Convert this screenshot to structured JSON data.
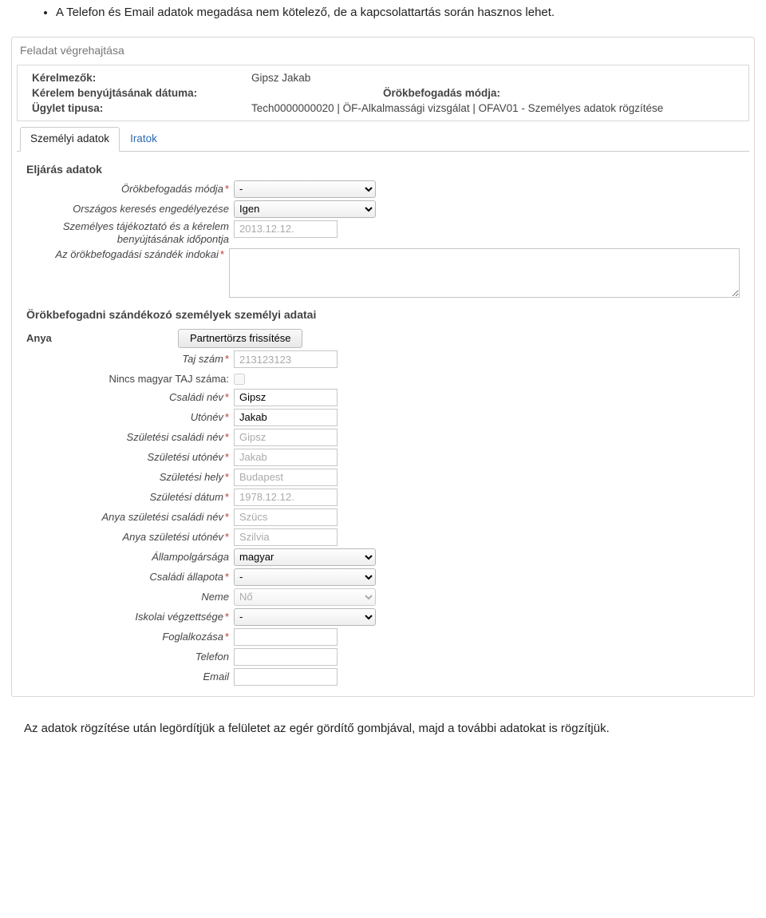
{
  "doc": {
    "bullet1": "A Telefon és Email adatok megadása nem kötelező, de a kapcsolattartás során hasznos lehet.",
    "footnote": "Az adatok rögzítése után legördítjük a felületet az egér gördítő gombjával, majd a további adatokat is rögzítjük."
  },
  "panel": {
    "title": "Feladat végrehajtása",
    "info": {
      "kerelmezok_lbl": "Kérelmezők:",
      "kerelmezok_val": "Gipsz Jakab",
      "benyujtas_lbl": "Kérelem benyújtásának dátuma:",
      "benyujtas_val": "",
      "orokmod_lbl": "Örökbefogadás módja:",
      "orokmod_val": "",
      "ugylet_lbl": "Ügylet tipusa:",
      "ugylet_val": "Tech0000000020 | ÖF-Alkalmassági vizsgálat | OFAV01 - Személyes adatok rögzítése"
    },
    "tabs": {
      "t1": "Személyi adatok",
      "t2": "Iratok"
    },
    "section1": "Eljárás adatok",
    "section2": "Örökbefogadni szándékozó személyek személyi adatai",
    "role": "Anya",
    "role_btn": "Partnertörzs frissítése",
    "labels": {
      "orokmod": "Örökbefogadás módja",
      "orszagos": "Országos keresés engedélyezése",
      "szemtaj": "Személyes tájékoztató és a kérelem benyújtásának időpontja",
      "szandek": "Az örökbefogadási szándék indokai",
      "taj": "Taj szám",
      "nincs_taj": "Nincs magyar TAJ száma:",
      "csaladi": "Családi név",
      "utonev": "Utónév",
      "szul_csaladi": "Születési családi név",
      "szul_utonev": "Születési utónév",
      "szul_hely": "Születési hely",
      "szul_datum": "Születési dátum",
      "anya_csaladi": "Anya születési családi név",
      "anya_utonev": "Anya születési utónév",
      "allampolg": "Állampolgársága",
      "csaladiall": "Családi állapota",
      "neme": "Neme",
      "iskolai": "Iskolai végzettsége",
      "foglalk": "Foglalkozása",
      "telefon": "Telefon",
      "email": "Email"
    },
    "values": {
      "orokmod": "-",
      "orszagos": "Igen",
      "szemtaj": "2013.12.12.",
      "szandek": "",
      "taj": "213123123",
      "csaladi": "Gipsz",
      "utonev": "Jakab",
      "szul_csaladi": "Gipsz",
      "szul_utonev": "Jakab",
      "szul_hely": "Budapest",
      "szul_datum": "1978.12.12.",
      "anya_csaladi": "Szücs",
      "anya_utonev": "Szilvia",
      "allampolg": "magyar",
      "csaladiall": "-",
      "neme": "Nő",
      "iskolai": "-",
      "foglalk": "",
      "telefon": "",
      "email": ""
    }
  }
}
